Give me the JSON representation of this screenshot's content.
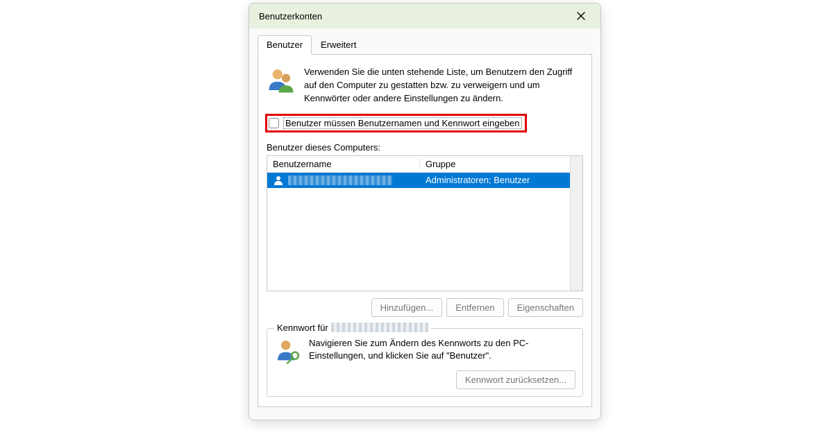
{
  "window": {
    "title": "Benutzerkonten"
  },
  "tabs": {
    "user": "Benutzer",
    "advanced": "Erweitert"
  },
  "intro": "Verwenden Sie die unten stehende Liste, um Benutzern den Zugriff auf den Computer zu gestatten bzw. zu verweigern und um Kennwörter oder andere Einstellungen zu ändern.",
  "checkbox_label": "Benutzer müssen Benutzernamen und Kennwort eingeben",
  "checkbox_checked": false,
  "users_section_label": "Benutzer dieses Computers:",
  "table": {
    "col_username": "Benutzername",
    "col_group": "Gruppe",
    "rows": [
      {
        "username": "[redacted]",
        "group": "Administratoren; Benutzer"
      }
    ]
  },
  "buttons": {
    "add": "Hinzufügen...",
    "remove": "Entfernen",
    "properties": "Eigenschaften"
  },
  "password_section": {
    "legend_prefix": "Kennwort für ",
    "legend_user": "[redacted]",
    "text": "Navigieren Sie zum Ändern des Kennworts zu den PC-Einstellungen, und klicken Sie auf \"Benutzer\".",
    "reset_button": "Kennwort zurücksetzen..."
  }
}
